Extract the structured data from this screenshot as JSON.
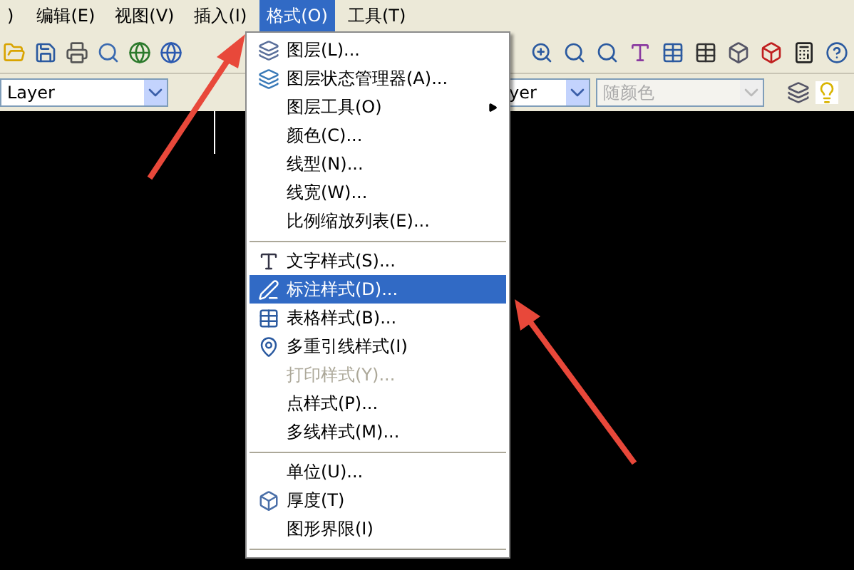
{
  "menu_bar": [
    {
      "label": ")",
      "selected": false
    },
    {
      "label": "编辑(E)",
      "selected": false
    },
    {
      "label": "视图(V)",
      "selected": false
    },
    {
      "label": "插入(I)",
      "selected": false
    },
    {
      "label": "格式(O)",
      "selected": true
    },
    {
      "label": "工具(T)",
      "selected": false
    }
  ],
  "layer_combo": {
    "value": "Layer"
  },
  "linetype_combo": {
    "value": "yer"
  },
  "color_combo": {
    "value": "随颜色",
    "disabled": true
  },
  "format_menu": [
    {
      "kind": "item",
      "label": "图层(L)...",
      "selected": false,
      "disabled": false,
      "submenu": false
    },
    {
      "kind": "item",
      "label": "图层状态管理器(A)...",
      "selected": false,
      "disabled": false,
      "submenu": false
    },
    {
      "kind": "item",
      "label": "图层工具(O)",
      "selected": false,
      "disabled": false,
      "submenu": true
    },
    {
      "kind": "item",
      "label": "颜色(C)...",
      "selected": false,
      "disabled": false,
      "submenu": false
    },
    {
      "kind": "item",
      "label": "线型(N)...",
      "selected": false,
      "disabled": false,
      "submenu": false
    },
    {
      "kind": "item",
      "label": "线宽(W)...",
      "selected": false,
      "disabled": false,
      "submenu": false
    },
    {
      "kind": "item",
      "label": "比例缩放列表(E)...",
      "selected": false,
      "disabled": false,
      "submenu": false
    },
    {
      "kind": "separator"
    },
    {
      "kind": "item",
      "label": "文字样式(S)...",
      "selected": false,
      "disabled": false,
      "submenu": false
    },
    {
      "kind": "item",
      "label": "标注样式(D)...",
      "selected": true,
      "disabled": false,
      "submenu": false
    },
    {
      "kind": "item",
      "label": "表格样式(B)...",
      "selected": false,
      "disabled": false,
      "submenu": false
    },
    {
      "kind": "item",
      "label": "多重引线样式(I)",
      "selected": false,
      "disabled": false,
      "submenu": false
    },
    {
      "kind": "item",
      "label": "打印样式(Y)...",
      "selected": false,
      "disabled": true,
      "submenu": false
    },
    {
      "kind": "item",
      "label": "点样式(P)...",
      "selected": false,
      "disabled": false,
      "submenu": false
    },
    {
      "kind": "item",
      "label": "多线样式(M)...",
      "selected": false,
      "disabled": false,
      "submenu": false
    },
    {
      "kind": "separator"
    },
    {
      "kind": "item",
      "label": "单位(U)...",
      "selected": false,
      "disabled": false,
      "submenu": false
    },
    {
      "kind": "item",
      "label": "厚度(T)",
      "selected": false,
      "disabled": false,
      "submenu": false
    },
    {
      "kind": "item",
      "label": "图形界限(I)",
      "selected": false,
      "disabled": false,
      "submenu": false
    },
    {
      "kind": "separator"
    }
  ]
}
